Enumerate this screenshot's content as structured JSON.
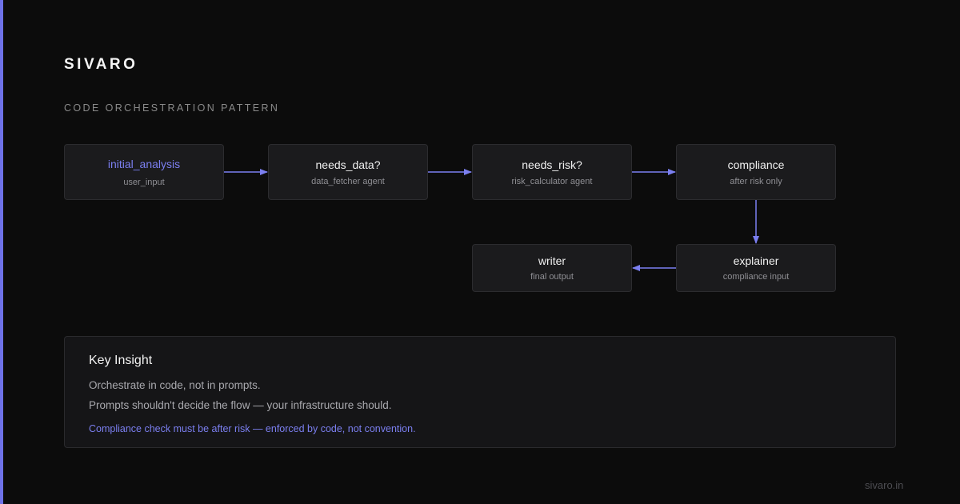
{
  "brand": "SIVARO",
  "section_title": "CODE ORCHESTRATION PATTERN",
  "colors": {
    "background": "#0c0c0c",
    "accent": "#6e72e8",
    "node_fill": "#1b1b1d",
    "highlight_text": "#7b7ff0"
  },
  "diagram": {
    "nodes": [
      {
        "id": "initial_analysis",
        "title": "initial_analysis",
        "subtitle": "user_input"
      },
      {
        "id": "needs_data",
        "title": "needs_data?",
        "subtitle": "data_fetcher agent"
      },
      {
        "id": "needs_risk",
        "title": "needs_risk?",
        "subtitle": "risk_calculator agent"
      },
      {
        "id": "compliance",
        "title": "compliance",
        "subtitle": "after risk only"
      },
      {
        "id": "explainer",
        "title": "explainer",
        "subtitle": "compliance input"
      },
      {
        "id": "writer",
        "title": "writer",
        "subtitle": "final output"
      }
    ],
    "edges": [
      {
        "from": "initial_analysis",
        "to": "needs_data"
      },
      {
        "from": "needs_data",
        "to": "needs_risk"
      },
      {
        "from": "needs_risk",
        "to": "compliance"
      },
      {
        "from": "compliance",
        "to": "explainer"
      },
      {
        "from": "explainer",
        "to": "writer"
      }
    ]
  },
  "insight": {
    "heading": "Key Insight",
    "line1": "Orchestrate in code, not in prompts.",
    "line2": "Prompts shouldn't decide the flow — your infrastructure should.",
    "note": "Compliance check must be after risk — enforced by code, not convention."
  },
  "footer": "sivaro.in"
}
